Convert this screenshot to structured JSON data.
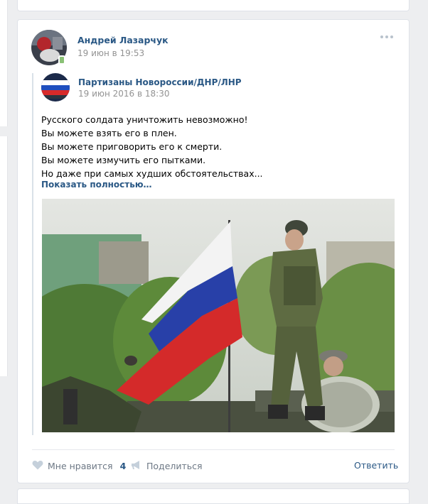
{
  "post": {
    "author": "Андрей Лазарчук",
    "date": "19 июн в 19:53"
  },
  "repost": {
    "source_name": "Партизаны Новороссии/ДНР/ЛНР",
    "source_date": "19 июн 2016 в 18:30",
    "text_lines": [
      "Русского солдата уничтожить невозможно!",
      "Вы можете взять его в плен.",
      "Вы можете приговорить его к смерти.",
      "Вы можете измучить его пытками.",
      "Но даже при самых худших обстоятельствах..."
    ],
    "show_more": "Показать полностью…"
  },
  "actions": {
    "like_label": "Мне нравится",
    "like_count": "4",
    "share_label": "Поделиться",
    "reply_label": "Ответить"
  },
  "colors": {
    "link": "#2a5885",
    "muted": "#939393",
    "background": "#edeef0",
    "online": "#8ac176"
  },
  "icons": [
    "heart-icon",
    "megaphone-icon",
    "more-dots-icon"
  ]
}
